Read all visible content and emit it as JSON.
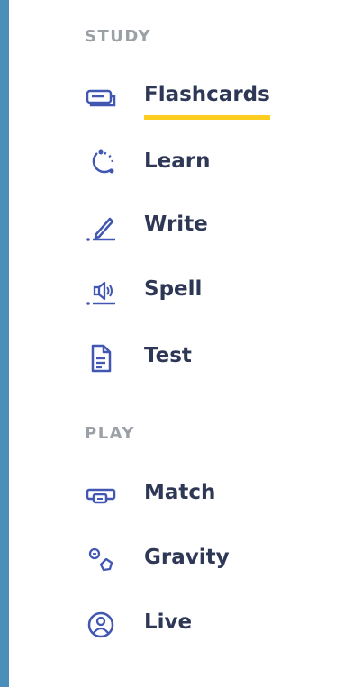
{
  "sections": {
    "study": {
      "title": "STUDY",
      "items": [
        {
          "label": "Flashcards",
          "icon": "flashcards-icon",
          "active": true
        },
        {
          "label": "Learn",
          "icon": "learn-icon"
        },
        {
          "label": "Write",
          "icon": "write-icon"
        },
        {
          "label": "Spell",
          "icon": "spell-icon"
        },
        {
          "label": "Test",
          "icon": "test-icon"
        }
      ]
    },
    "play": {
      "title": "PLAY",
      "items": [
        {
          "label": "Match",
          "icon": "match-icon"
        },
        {
          "label": "Gravity",
          "icon": "gravity-icon"
        },
        {
          "label": "Live",
          "icon": "live-icon"
        }
      ]
    }
  },
  "colors": {
    "accent": "#ffcd1f",
    "icon": "#4257b2",
    "text": "#2e3856",
    "section_title": "#9aa0a6",
    "frame": "#4a8fba"
  }
}
